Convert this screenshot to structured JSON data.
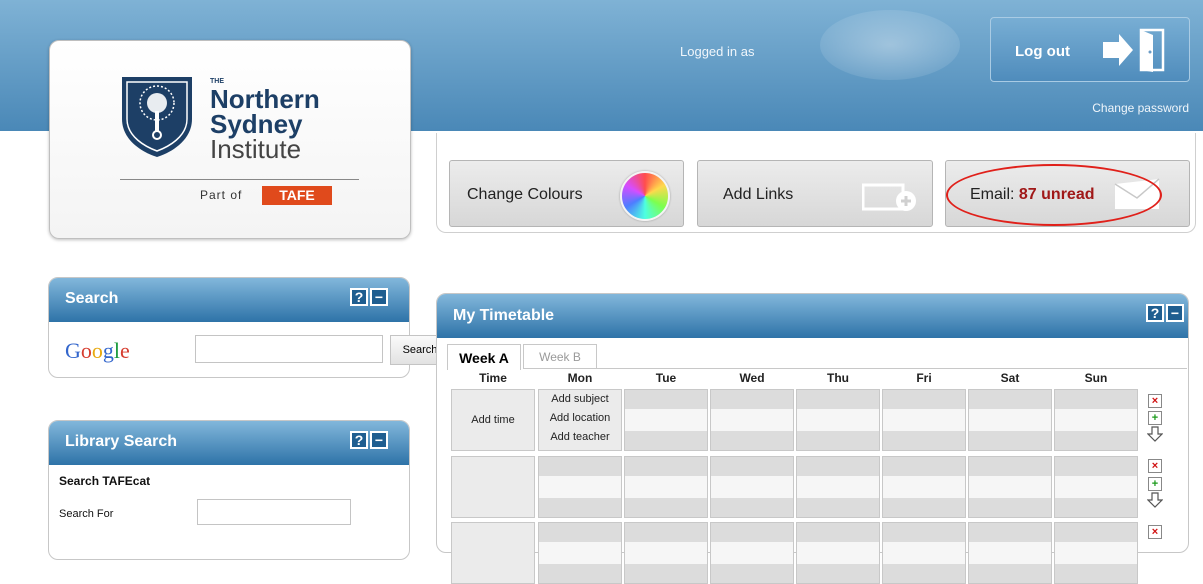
{
  "header": {
    "logged_in_text": "Logged in as",
    "logout_label": "Log out",
    "change_password": "Change password"
  },
  "logo": {
    "the": "THE",
    "line1": "Northern",
    "line2": "Sydney",
    "line3": "Institute",
    "part_of": "Part of",
    "tafe": "TAFE"
  },
  "tools": {
    "change_colours": "Change Colours",
    "add_links": "Add Links",
    "email_prefix": "Email:",
    "email_count": "87 unread"
  },
  "search_widget": {
    "title": "Search",
    "google": [
      "G",
      "o",
      "o",
      "g",
      "l",
      "e"
    ],
    "google_colors": [
      "#3366cc",
      "#d63c2e",
      "#e8a90f",
      "#3366cc",
      "#1a9a3c",
      "#d63c2e"
    ],
    "button": "Search",
    "help": "?",
    "minimize": "−"
  },
  "library_widget": {
    "title": "Library Search",
    "subtitle": "Search TAFEcat",
    "search_for_label": "Search For",
    "help": "?",
    "minimize": "−"
  },
  "timetable": {
    "title": "My Timetable",
    "help": "?",
    "minimize": "−",
    "tabs": [
      "Week A",
      "Week B"
    ],
    "columns": [
      "Time",
      "Mon",
      "Tue",
      "Wed",
      "Thu",
      "Fri",
      "Sat",
      "Sun"
    ],
    "row1": {
      "time": "Add time",
      "mon": [
        "Add subject",
        "Add location",
        "Add teacher"
      ]
    },
    "row_actions": {
      "delete": "×",
      "add": "+"
    }
  },
  "colors": {
    "header_top": "#7fb2d5",
    "header_bottom": "#4a88b7",
    "widget_header": "#2e73a8",
    "email_highlight": "#e0201a",
    "email_count": "#a01818"
  }
}
